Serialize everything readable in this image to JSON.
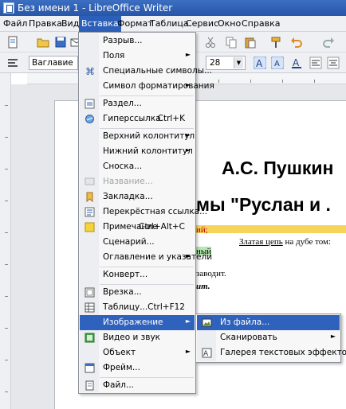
{
  "window": {
    "title": "Без имени 1 - LibreOffice Writer"
  },
  "menubar": [
    {
      "label": "Файл"
    },
    {
      "label": "Правка"
    },
    {
      "label": "Вид"
    },
    {
      "label": "Вставка"
    },
    {
      "label": "Формат"
    },
    {
      "label": "Таблица"
    },
    {
      "label": "Сервис"
    },
    {
      "label": "Окно"
    },
    {
      "label": "Справка"
    }
  ],
  "toolbar": {
    "style_value": "Ваглавие",
    "size_value": "28"
  },
  "document": {
    "title": "А.С. Пушкин",
    "subtitle": "мы \"Руслан и .",
    "frag_red": "ий;",
    "frag_green": "ный",
    "frag_chain_a": "Златая цепь",
    "frag_chain_b": " на дубе том:",
    "frag_zavodit": "заводит.",
    "frag_bold": "ит."
  },
  "insert_menu": {
    "items": [
      {
        "label": "Разрыв...",
        "shortcut": "",
        "arrow": "",
        "icon": ""
      },
      {
        "label": "Поля",
        "shortcut": "",
        "arrow": "►",
        "icon": ""
      },
      {
        "label": "Специальные символы...",
        "shortcut": "",
        "arrow": "",
        "icon": "omega-icon"
      },
      {
        "label": "Символ форматирования",
        "shortcut": "",
        "arrow": "►",
        "icon": ""
      },
      {
        "label": "Раздел...",
        "shortcut": "",
        "arrow": "",
        "icon": "section-icon"
      },
      {
        "label": "Гиперссылка",
        "shortcut": "Ctrl+K",
        "arrow": "",
        "icon": "hyperlink-icon"
      },
      {
        "label": "Верхний колонтитул",
        "shortcut": "",
        "arrow": "►",
        "icon": ""
      },
      {
        "label": "Нижний колонтитул",
        "shortcut": "",
        "arrow": "►",
        "icon": ""
      },
      {
        "label": "Сноска...",
        "shortcut": "",
        "arrow": "",
        "icon": ""
      },
      {
        "label": "Название...",
        "shortcut": "",
        "arrow": "",
        "icon": "caption-icon"
      },
      {
        "label": "Закладка...",
        "shortcut": "",
        "arrow": "",
        "icon": "bookmark-icon"
      },
      {
        "label": "Перекрёстная ссылка...",
        "shortcut": "",
        "arrow": "",
        "icon": "cross-reference-icon"
      },
      {
        "label": "Примечание",
        "shortcut": "Ctrl+Alt+C",
        "arrow": "",
        "icon": "comment-icon"
      },
      {
        "label": "Сценарий...",
        "shortcut": "",
        "arrow": "",
        "icon": ""
      },
      {
        "label": "Оглавление и указатели",
        "shortcut": "",
        "arrow": "►",
        "icon": ""
      },
      {
        "label": "Конверт...",
        "shortcut": "",
        "arrow": "",
        "icon": ""
      },
      {
        "label": "Врезка...",
        "shortcut": "",
        "arrow": "",
        "icon": "frame-icon"
      },
      {
        "label": "Таблицу...",
        "shortcut": "Ctrl+F12",
        "arrow": "",
        "icon": "table-icon"
      },
      {
        "label": "Изображение",
        "shortcut": "",
        "arrow": "►",
        "icon": ""
      },
      {
        "label": "Видео и звук",
        "shortcut": "",
        "arrow": "",
        "icon": "media-icon"
      },
      {
        "label": "Объект",
        "shortcut": "",
        "arrow": "►",
        "icon": ""
      },
      {
        "label": "Фрейм...",
        "shortcut": "",
        "arrow": "",
        "icon": "floating-frame-icon"
      },
      {
        "label": "Файл...",
        "shortcut": "",
        "arrow": "",
        "icon": "file-icon"
      }
    ]
  },
  "image_submenu": {
    "items": [
      {
        "label": "Из файла...",
        "arrow": "",
        "icon": "picture-icon"
      },
      {
        "label": "Сканировать",
        "arrow": "►",
        "icon": ""
      },
      {
        "label": "Галерея текстовых эффектов...",
        "arrow": "",
        "icon": "fontwork-icon"
      }
    ]
  },
  "colors": {
    "accent": "#2f62bd",
    "titlebar": "#2855a8",
    "highlight_yellow": "#f6d45a"
  }
}
